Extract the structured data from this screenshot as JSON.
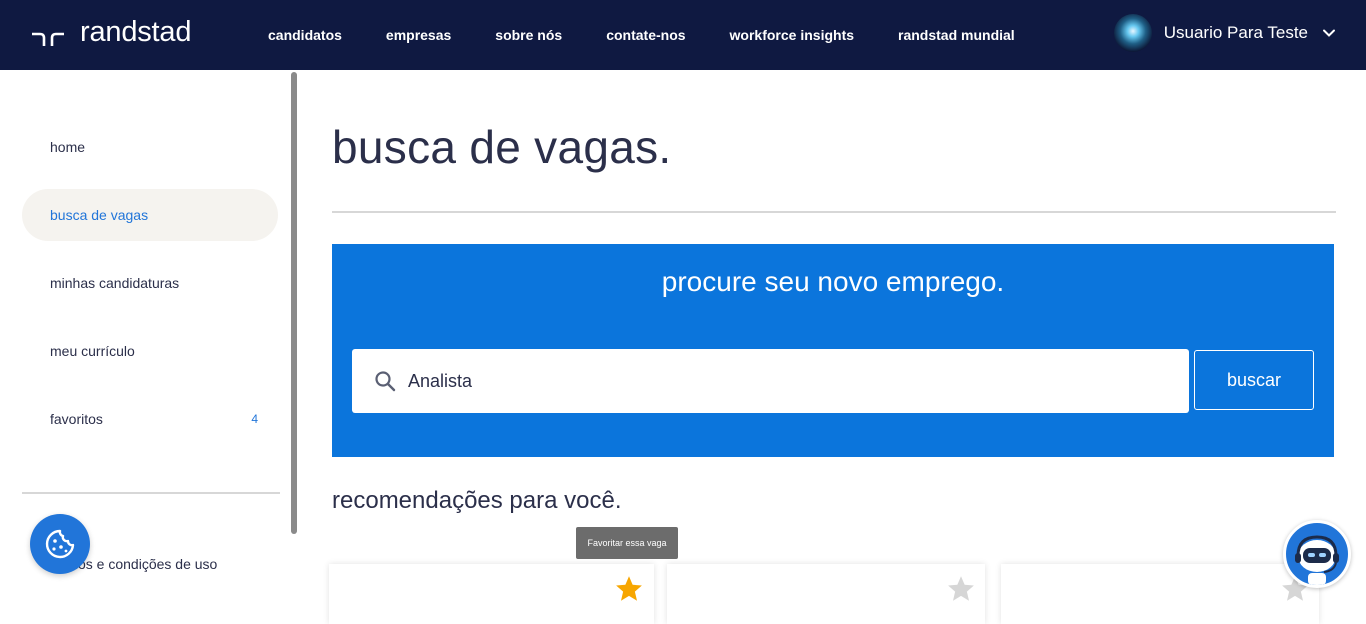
{
  "header": {
    "logo_text": "randstad",
    "nav": [
      {
        "label": "candidatos"
      },
      {
        "label": "empresas"
      },
      {
        "label": "sobre nós"
      },
      {
        "label": "contate-nos"
      },
      {
        "label": "workforce insights"
      },
      {
        "label": "randstad mundial"
      }
    ],
    "user_name": "Usuario Para Teste"
  },
  "sidebar": {
    "items": [
      {
        "label": "home"
      },
      {
        "label": "busca de vagas"
      },
      {
        "label": "minhas candidaturas"
      },
      {
        "label": "meu currículo"
      },
      {
        "label": "favoritos",
        "count": "4"
      }
    ],
    "terms_label": "termos e condições de uso"
  },
  "main": {
    "title": "busca de vagas.",
    "search": {
      "heading": "procure seu novo emprego.",
      "value": "Analista",
      "button_label": "buscar"
    },
    "recommendations_heading": "recomendações para você.",
    "tooltip": "Favoritar essa vaga",
    "cards": [
      {
        "favorited": true
      },
      {
        "favorited": false
      },
      {
        "favorited": false
      }
    ]
  },
  "icons": {
    "logo": "randstad-logo-icon",
    "user_menu": "chevron-down-icon",
    "search": "search-icon",
    "star": "star-icon",
    "cookie": "cookie-icon",
    "chatbot": "chatbot-icon"
  },
  "colors": {
    "navy": "#0f1941",
    "brand_blue": "#2175d9",
    "panel_blue": "#0b75dc",
    "star_active": "#f7a600",
    "star_inactive": "#d6d6d6"
  }
}
